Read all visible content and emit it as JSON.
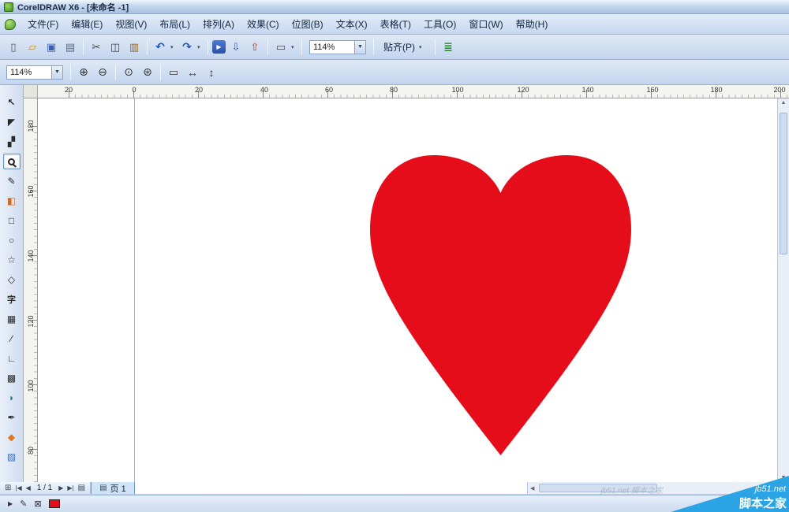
{
  "window": {
    "title": "CorelDRAW X6 - [未命名 -1]"
  },
  "menu": {
    "items": [
      "文件(F)",
      "编辑(E)",
      "视图(V)",
      "布局(L)",
      "排列(A)",
      "效果(C)",
      "位图(B)",
      "文本(X)",
      "表格(T)",
      "工具(O)",
      "窗口(W)",
      "帮助(H)"
    ]
  },
  "standard_toolbar": {
    "zoom_value": "114%",
    "snap_label": "贴齐(P)",
    "buttons": [
      "new-document",
      "open",
      "save",
      "print",
      "cut",
      "copy",
      "paste",
      "undo",
      "redo",
      "application-launcher",
      "import",
      "export",
      "full-screen-preview",
      "zoom-level-combo",
      "snap-to-dropdown",
      "options"
    ]
  },
  "property_bar": {
    "zoom_value": "114%",
    "buttons": [
      "zoom-in",
      "zoom-out",
      "zoom-to-selection",
      "zoom-to-all-objects",
      "zoom-to-page",
      "zoom-to-page-width",
      "zoom-to-page-height"
    ]
  },
  "toolbox": {
    "selected": "zoom-tool",
    "tools": [
      "pick-tool",
      "shape-tool",
      "crop-tool",
      "zoom-tool",
      "freehand-tool",
      "smart-fill-tool",
      "rectangle-tool",
      "ellipse-tool",
      "polygon-tool",
      "basic-shapes-tool",
      "text-tool",
      "table-tool",
      "parallel-dimension-tool",
      "straight-line-connector-tool",
      "blend-tool",
      "color-eyedropper-tool",
      "outline-pen-tool",
      "fill-tool",
      "interactive-fill-tool"
    ]
  },
  "rulers": {
    "horizontal": [
      "20",
      "0",
      "20",
      "40",
      "60",
      "80",
      "100",
      "120",
      "140",
      "160",
      "180",
      "200"
    ],
    "vertical": [
      "180",
      "160",
      "140",
      "120",
      "100",
      "80"
    ]
  },
  "canvas": {
    "object": "heart",
    "fill": "#e60d1b"
  },
  "page_bar": {
    "page_indicator": "1 / 1",
    "active_tab": "页 1"
  },
  "status_bar": {
    "fill_swatch": "#e60d1b"
  },
  "watermark": {
    "site": "jb51.net",
    "name": "脚本之家",
    "faint": "jb51.net 脚本之家",
    "color": "#2aa4e4"
  }
}
